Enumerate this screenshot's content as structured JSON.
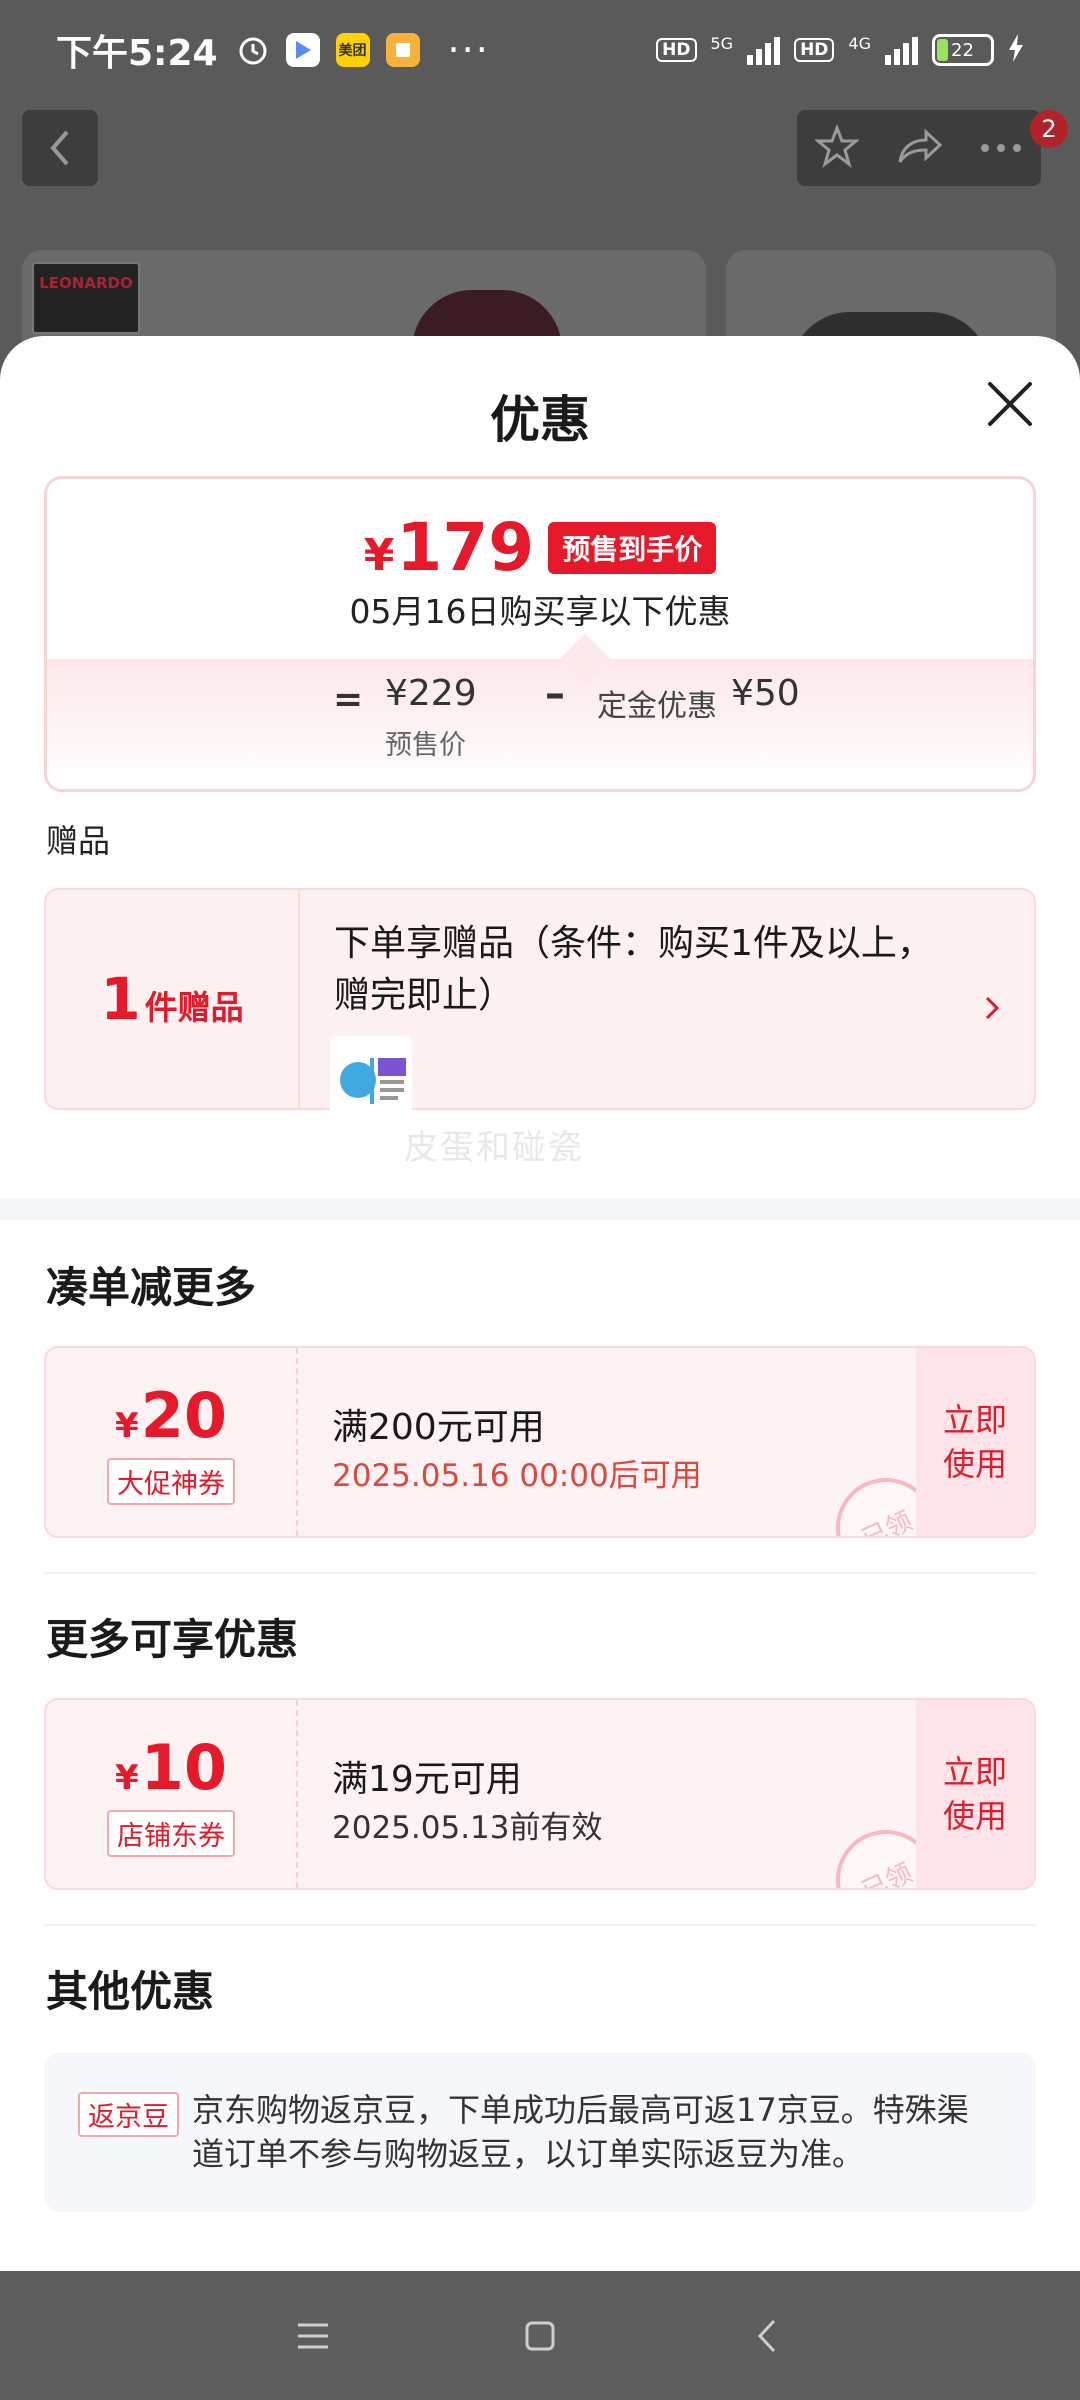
{
  "status_bar": {
    "time": "下午5:24",
    "icons": [
      "alarm-icon",
      "play-store-icon",
      "meituan-icon",
      "notes-icon",
      "more-dots-icon"
    ],
    "meituan_label": "美团",
    "more": "···",
    "hd1": "HD",
    "net1": "5G",
    "hd2": "HD",
    "net2": "4G",
    "battery": "22"
  },
  "background": {
    "cart_badge": "2",
    "logo_text": "LEONARDO"
  },
  "sheet": {
    "title": "优惠"
  },
  "price_box": {
    "currency": "¥",
    "final_price": "179",
    "final_tag": "预售到手价",
    "purchase_date_note": "05月16日购买享以下优惠",
    "equals": "=",
    "presale_price": "¥229",
    "presale_label": "预售价",
    "minus": "–",
    "deposit_label": "定金优惠",
    "deposit_value": "¥50"
  },
  "gifts": {
    "section_label": "赠品",
    "count": "1",
    "count_unit": "件赠品",
    "description": "下单享赠品（条件：购买1件及以上，赠完即止）",
    "watermark": "皮蛋和碰瓷"
  },
  "bundle": {
    "title": "凑单减更多",
    "coupon": {
      "currency": "¥",
      "value": "20",
      "type": "大促神券",
      "condition": "满200元可用",
      "validity": "2025.05.16 00:00后可用",
      "action": "立即使用",
      "stamp": "已领"
    }
  },
  "more_offers": {
    "title": "更多可享优惠",
    "coupon": {
      "currency": "¥",
      "value": "10",
      "type": "店铺东券",
      "condition": "满19元可用",
      "validity": "2025.05.13前有效",
      "action": "立即使用",
      "stamp": "已领"
    }
  },
  "other": {
    "title": "其他优惠",
    "tag": "返京豆",
    "text": "京东购物返京豆，下单成功后最高可返17京豆。特殊渠道订单不参与购物返豆，以订单实际返豆为准。"
  },
  "colors": {
    "accent": "#e6192b",
    "date_red": "#e2453b",
    "card_bg": "#fef3f4"
  }
}
